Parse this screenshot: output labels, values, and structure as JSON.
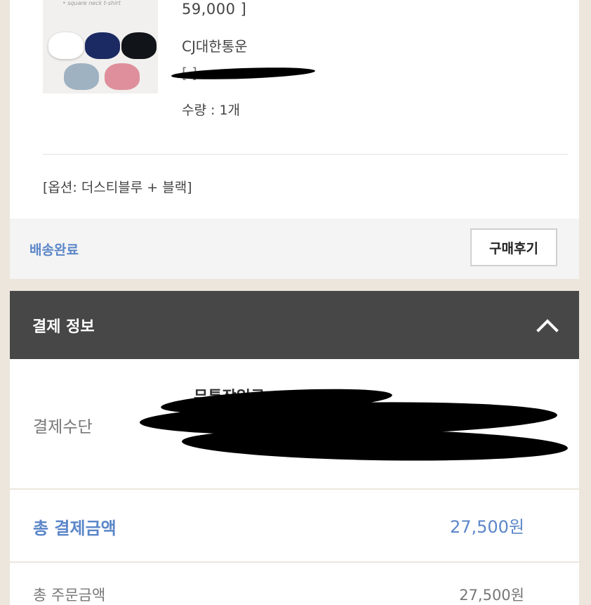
{
  "order": {
    "thumbnail_caption": "• square neck t-shirt",
    "price": "59,000 ]",
    "carrier": "CJ대한통운",
    "tracking": "[                                   ]",
    "quantity": "수량 : 1개",
    "option": "[옵션: 더스티블루 + 블랙]",
    "status": "배송완료",
    "review_button": "구매후기",
    "shirt_colors": [
      "#ffffff",
      "#1c2a63",
      "#111418",
      "#9fb2c2",
      "#de8f9b"
    ]
  },
  "payment": {
    "header": "결제 정보",
    "collapse_icon": "chevron-up-icon",
    "method_label": "결제수단",
    "method_name": "무통장입금",
    "total_label": "총 결제금액",
    "total_value": "27,500원",
    "subtotal_label": "총 주문금액",
    "subtotal_value": "27,500원"
  },
  "colors": {
    "accent": "#5b86c8",
    "header_bg": "#474747",
    "page_bg": "#ece6dd"
  }
}
